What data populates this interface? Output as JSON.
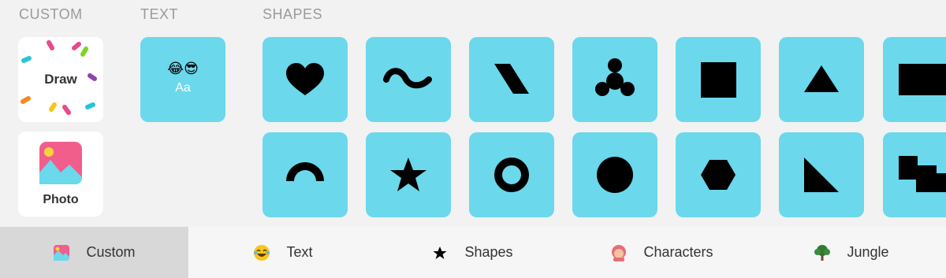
{
  "sections": {
    "custom": "CUSTOM",
    "text": "TEXT",
    "shapes": "SHAPES"
  },
  "custom_tiles": {
    "draw": "Draw",
    "photo": "Photo"
  },
  "text_tile": {
    "emoji": "😂😎",
    "sample": "Aa"
  },
  "shapes": {
    "row1": [
      "heart",
      "wave",
      "parallelogram",
      "trefoil",
      "square",
      "triangle",
      "rectangle"
    ],
    "row2": [
      "arch",
      "star",
      "ring",
      "circle",
      "hexagon",
      "right-triangle",
      "zigzag"
    ]
  },
  "tabs": [
    {
      "label": "Custom",
      "icon": "photo-icon",
      "active": true
    },
    {
      "label": "Text",
      "icon": "laughing-emoji-icon",
      "active": false
    },
    {
      "label": "Shapes",
      "icon": "star-icon",
      "active": false
    },
    {
      "label": "Characters",
      "icon": "character-face-icon",
      "active": false
    },
    {
      "label": "Jungle",
      "icon": "tree-icon",
      "active": false
    }
  ],
  "colors": {
    "tile_blue": "#6bd8ec",
    "active_tab": "#d8d8d8",
    "label_gray": "#9a9a9a"
  }
}
